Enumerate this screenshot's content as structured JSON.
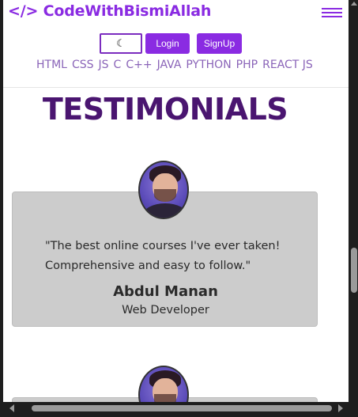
{
  "header": {
    "brand": "</> CodeWithBismiAllah",
    "menu_icon": "hamburger-menu-icon",
    "theme_icon": "moon-icon",
    "theme_glyph": "☾",
    "login_label": "Login",
    "signup_label": "SignUp"
  },
  "nav": {
    "languages": [
      "HTML",
      "CSS",
      "JS",
      "C",
      "C++",
      "JAVA",
      "PYTHON",
      "PHP",
      "REACT JS"
    ]
  },
  "testimonials": {
    "title": "TESTIMONIALS",
    "items": [
      {
        "quote": "\"The best online courses I've ever taken! Comprehensive and easy to follow.\"",
        "name": "Abdul Manan",
        "role": "Web Developer",
        "avatar": "user-avatar"
      }
    ]
  },
  "colors": {
    "brand": "#8a2be2",
    "title": "#4a1570",
    "nav_link": "#8a64b8",
    "card_bg": "#cccccc"
  }
}
